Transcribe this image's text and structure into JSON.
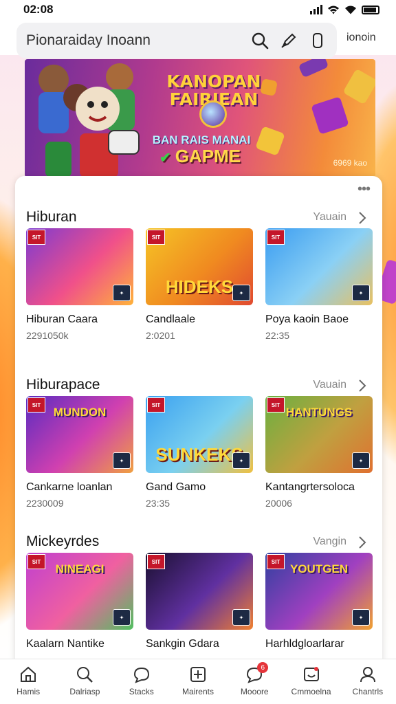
{
  "status_bar": {
    "time": "02:08"
  },
  "search": {
    "text": "Pionaraiday Inoann",
    "link": "ionoin"
  },
  "hero": {
    "title": "KANOPAN FAIRIEAN",
    "subtitle": "BAN RAIS MANAI",
    "game": "GAPME",
    "tag": "6969 kao"
  },
  "sections": [
    {
      "title": "Hiburan",
      "more": "Yauain",
      "items": [
        {
          "name": "Hiburan Caara",
          "meta": "2291050k",
          "art": "",
          "art_top": "",
          "colors": [
            "#7d3bd0",
            "#f0508a",
            "#ffb23a"
          ]
        },
        {
          "name": "Candlaale",
          "meta": "2:0201",
          "art": "HIDEKS",
          "art_top": "",
          "colors": [
            "#f5c426",
            "#f08a20",
            "#e04a30"
          ]
        },
        {
          "name": "Poya kaoin Baoe",
          "meta": "22:35",
          "art": "",
          "art_top": "",
          "colors": [
            "#3a9cf0",
            "#8ad0f5",
            "#e8c060"
          ]
        }
      ]
    },
    {
      "title": "Hiburapace",
      "more": "Vauain",
      "items": [
        {
          "name": "Cankarne loanlan",
          "meta": "2230009",
          "art": "",
          "art_top": "MUNDON",
          "colors": [
            "#5a2cc0",
            "#d040b0",
            "#f0a040"
          ]
        },
        {
          "name": "Gand Gamo",
          "meta": "23:35",
          "art": "SUNKEKS",
          "art_top": "",
          "colors": [
            "#3aa0f0",
            "#7ad0f0",
            "#f0c040"
          ]
        },
        {
          "name": "Kantangrtersoloca",
          "meta": "20006",
          "art": "",
          "art_top": "HANTUNGS",
          "colors": [
            "#6ab040",
            "#c0a040",
            "#e07030"
          ]
        }
      ]
    },
    {
      "title": "Mickeyrdes",
      "more": "Vangin",
      "items": [
        {
          "name": "Kaalarn Nantike",
          "meta": "",
          "art": "",
          "art_top": "NINEAGI",
          "colors": [
            "#c040d0",
            "#f060a0",
            "#50c060"
          ]
        },
        {
          "name": "Sankgin Gdara",
          "meta": "",
          "art": "",
          "art_top": "",
          "colors": [
            "#1a1030",
            "#6030a0",
            "#f08030"
          ]
        },
        {
          "name": "Harhldgloarlarar",
          "meta": "",
          "art": "",
          "art_top": "YOUTGEN",
          "colors": [
            "#3040a0",
            "#a040c0",
            "#f0a030"
          ]
        }
      ]
    }
  ],
  "bottom_nav": [
    {
      "label": "Hamis",
      "icon": "home-icon"
    },
    {
      "label": "Dalriasp",
      "icon": "search-icon"
    },
    {
      "label": "Stacks",
      "icon": "chat-bubble-icon"
    },
    {
      "label": "Mairents",
      "icon": "grid-card-icon"
    },
    {
      "label": "Mooore",
      "icon": "message-icon",
      "badge": "6"
    },
    {
      "label": "Cmmoelna",
      "icon": "game-card-icon"
    },
    {
      "label": "Chantrls",
      "icon": "profile-icon"
    }
  ],
  "colors": {
    "accent": "#c4162a",
    "hero_text": "#ffd23a"
  }
}
